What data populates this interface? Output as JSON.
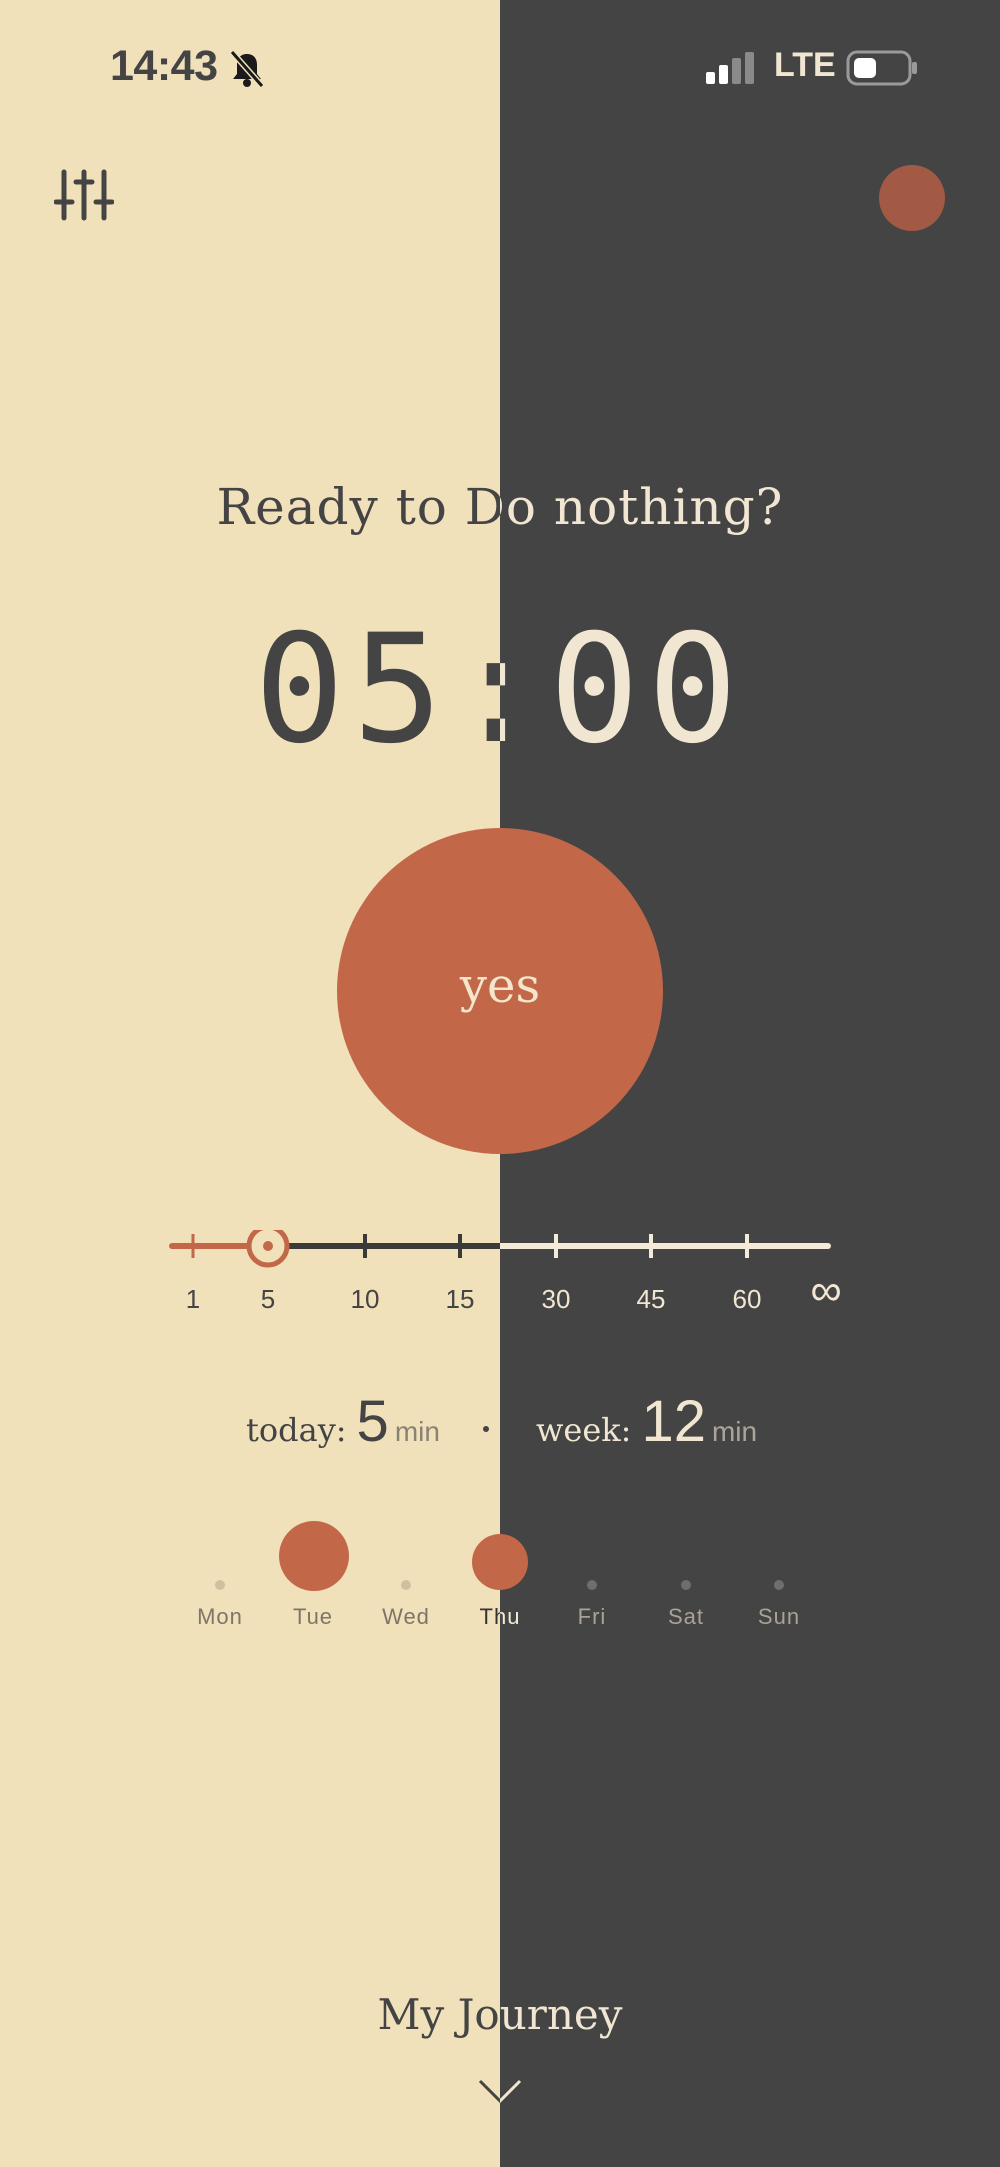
{
  "status_bar": {
    "time": "14:43",
    "network": "LTE"
  },
  "colors": {
    "cream": "#F0E1BB",
    "charcoal": "#444444",
    "accent": "#C36749",
    "muted_accent": "#A35A45"
  },
  "icons": {
    "settings": "sliders-icon",
    "bell": "bell-muted-icon",
    "signal": "signal-icon",
    "battery": "battery-icon",
    "chevron": "chevron-down-icon"
  },
  "main": {
    "prompt": "Ready to Do nothing?",
    "timer": "05:00",
    "start_button": "yes"
  },
  "duration_slider": {
    "ticks": [
      "1",
      "5",
      "10",
      "15",
      "30",
      "45",
      "60",
      "∞"
    ],
    "selected": "5"
  },
  "stats": {
    "today_label": "today:",
    "today_value": "5",
    "today_unit": "min",
    "week_label": "week:",
    "week_value": "12",
    "week_unit": "min"
  },
  "week": {
    "days": [
      {
        "label": "Mon",
        "minutes": 0
      },
      {
        "label": "Tue",
        "minutes": 7
      },
      {
        "label": "Wed",
        "minutes": 0
      },
      {
        "label": "Thu",
        "minutes": 5
      },
      {
        "label": "Fri",
        "minutes": 0
      },
      {
        "label": "Sat",
        "minutes": 0
      },
      {
        "label": "Sun",
        "minutes": 0
      }
    ]
  },
  "footer": {
    "title": "My Journey"
  }
}
